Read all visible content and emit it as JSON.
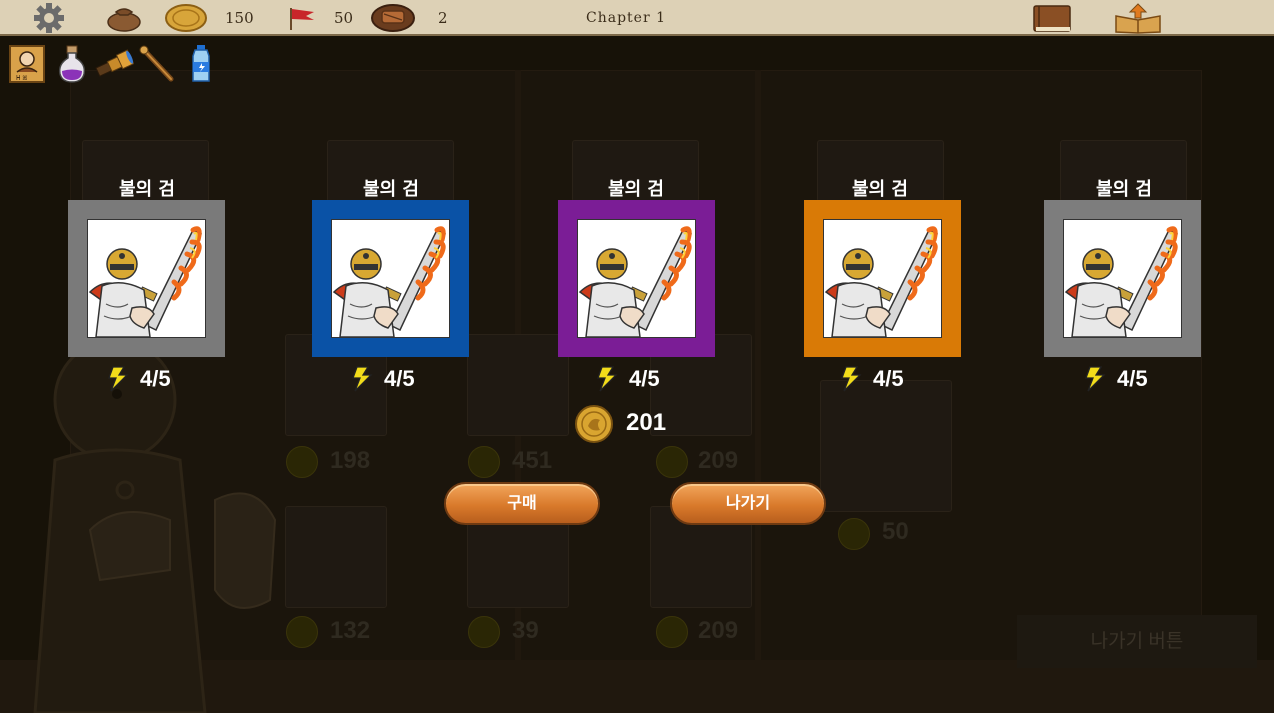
{
  "topbar": {
    "gold": "150",
    "flags": "50",
    "food": "2",
    "chapter": "Chapter 1"
  },
  "inventory": [
    "portrait-scroll-icon",
    "purple-potion-icon",
    "spyglass-icon",
    "wand-icon",
    "water-bottle-icon"
  ],
  "cards": [
    {
      "name": "불의 검",
      "stat": "4/5",
      "frame_color": "#7a7a7a"
    },
    {
      "name": "불의 검",
      "stat": "4/5",
      "frame_color": "#0a52a6"
    },
    {
      "name": "불의 검",
      "stat": "4/5",
      "frame_color": "#7b1d96"
    },
    {
      "name": "불의 검",
      "stat": "4/5",
      "frame_color": "#d97a06"
    },
    {
      "name": "불의 검",
      "stat": "4/5",
      "frame_color": "#7d7d7d"
    }
  ],
  "price": "201",
  "buttons": {
    "buy": "구매",
    "exit": "나가기"
  },
  "background": {
    "prices_row1": [
      "198",
      "451",
      "209"
    ],
    "prices_row2": [
      "132",
      "39",
      "209"
    ],
    "price_side": "50",
    "exit_button": "나가기 버튼"
  }
}
